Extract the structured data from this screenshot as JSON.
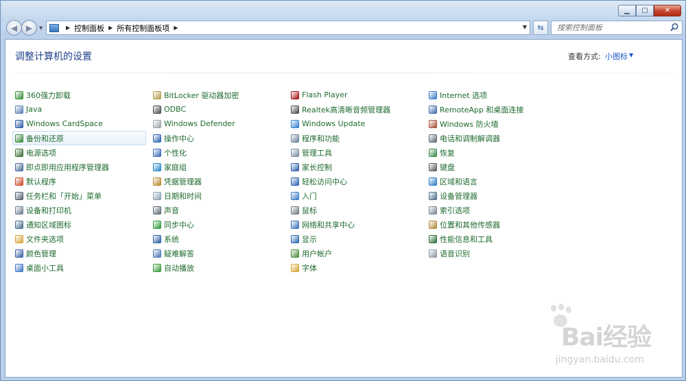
{
  "window": {
    "caption_buttons": [
      "minimize-icon",
      "maximize-icon",
      "close-icon"
    ]
  },
  "nav": {
    "breadcrumbs": [
      "控制面板",
      "所有控制面板项"
    ],
    "search_placeholder": "搜索控制面板"
  },
  "header": {
    "title": "调整计算机的设置",
    "view_by_label": "查看方式:",
    "view_by_value": "小图标"
  },
  "columns": [
    [
      {
        "label": "360强力卸载",
        "icon": "uninstall-icon",
        "color": "#3a8f3a"
      },
      {
        "label": "Java",
        "icon": "java-icon",
        "color": "#5b7fb5"
      },
      {
        "label": "Windows CardSpace",
        "icon": "cardspace-icon",
        "color": "#2a5ea8"
      },
      {
        "label": "备份和还原",
        "icon": "backup-icon",
        "color": "#3d8b3d"
      },
      {
        "label": "电源选项",
        "icon": "power-icon",
        "color": "#3c6e2e"
      },
      {
        "label": "即点即用应用程序管理器",
        "icon": "app-manager-icon",
        "color": "#4a6b9a"
      },
      {
        "label": "默认程序",
        "icon": "default-programs-icon",
        "color": "#d04a2a"
      },
      {
        "label": "任务栏和「开始」菜单",
        "icon": "taskbar-icon",
        "color": "#506070"
      },
      {
        "label": "设备和打印机",
        "icon": "printer-icon",
        "color": "#6a7c8f"
      },
      {
        "label": "通知区域图标",
        "icon": "notification-icon",
        "color": "#4b6d92"
      },
      {
        "label": "文件夹选项",
        "icon": "folder-options-icon",
        "color": "#d6a534"
      },
      {
        "label": "颜色管理",
        "icon": "color-management-icon",
        "color": "#3660a6"
      },
      {
        "label": "桌面小工具",
        "icon": "gadgets-icon",
        "color": "#3e78c4"
      }
    ],
    [
      {
        "label": "BitLocker 驱动器加密",
        "icon": "bitlocker-icon",
        "color": "#b59b4e"
      },
      {
        "label": "ODBC",
        "icon": "odbc-icon",
        "color": "#4b4b4b"
      },
      {
        "label": "Windows Defender",
        "icon": "defender-icon",
        "color": "#9aa4ad"
      },
      {
        "label": "操作中心",
        "icon": "action-center-icon",
        "color": "#2f62b6"
      },
      {
        "label": "个性化",
        "icon": "personalization-icon",
        "color": "#3b6bb5"
      },
      {
        "label": "家庭组",
        "icon": "homegroup-icon",
        "color": "#2a86c8"
      },
      {
        "label": "凭据管理器",
        "icon": "credential-icon",
        "color": "#b78a2b"
      },
      {
        "label": "日期和时间",
        "icon": "clock-icon",
        "color": "#8ea0b3"
      },
      {
        "label": "声音",
        "icon": "sound-icon",
        "color": "#5d6b78"
      },
      {
        "label": "同步中心",
        "icon": "sync-icon",
        "color": "#2e9b3c"
      },
      {
        "label": "系统",
        "icon": "system-icon",
        "color": "#2c5fa5"
      },
      {
        "label": "疑难解答",
        "icon": "troubleshoot-icon",
        "color": "#4a7ab6"
      },
      {
        "label": "自动播放",
        "icon": "autoplay-icon",
        "color": "#3a9a3a"
      }
    ],
    [
      {
        "label": "Flash Player",
        "icon": "flash-icon",
        "color": "#a31212"
      },
      {
        "label": "Realtek高清晰音频管理器",
        "icon": "audio-manager-icon",
        "color": "#4a4a4a"
      },
      {
        "label": "Windows Update",
        "icon": "update-icon",
        "color": "#2f7fd0"
      },
      {
        "label": "程序和功能",
        "icon": "programs-icon",
        "color": "#6b7f98"
      },
      {
        "label": "管理工具",
        "icon": "admin-tools-icon",
        "color": "#7a8ca0"
      },
      {
        "label": "家长控制",
        "icon": "parental-icon",
        "color": "#3060a8"
      },
      {
        "label": "轻松访问中心",
        "icon": "ease-of-access-icon",
        "color": "#2e63b5"
      },
      {
        "label": "入门",
        "icon": "getting-started-icon",
        "color": "#3c7dc8"
      },
      {
        "label": "鼠标",
        "icon": "mouse-icon",
        "color": "#707a84"
      },
      {
        "label": "网络和共享中心",
        "icon": "network-icon",
        "color": "#3770b8"
      },
      {
        "label": "显示",
        "icon": "display-icon",
        "color": "#2f68b0"
      },
      {
        "label": "用户帐户",
        "icon": "user-accounts-icon",
        "color": "#4d8c3c"
      },
      {
        "label": "字体",
        "icon": "fonts-icon",
        "color": "#d5a437"
      }
    ],
    [
      {
        "label": "Internet 选项",
        "icon": "internet-options-icon",
        "color": "#3a7fc8"
      },
      {
        "label": "RemoteApp 和桌面连接",
        "icon": "remoteapp-icon",
        "color": "#3e6da8"
      },
      {
        "label": "Windows 防火墙",
        "icon": "firewall-icon",
        "color": "#a8503a"
      },
      {
        "label": "电话和调制解调器",
        "icon": "phone-icon",
        "color": "#5f6b76"
      },
      {
        "label": "恢复",
        "icon": "recovery-icon",
        "color": "#3a8a4a"
      },
      {
        "label": "键盘",
        "icon": "keyboard-icon",
        "color": "#5a5a5a"
      },
      {
        "label": "区域和语言",
        "icon": "region-icon",
        "color": "#2f7ec4"
      },
      {
        "label": "设备管理器",
        "icon": "device-manager-icon",
        "color": "#4f6e8e"
      },
      {
        "label": "索引选项",
        "icon": "indexing-icon",
        "color": "#7a8594"
      },
      {
        "label": "位置和其他传感器",
        "icon": "location-icon",
        "color": "#b08a3a"
      },
      {
        "label": "性能信息和工具",
        "icon": "performance-icon",
        "color": "#2e6e3a"
      },
      {
        "label": "语音识别",
        "icon": "microphone-icon",
        "color": "#8d98a4"
      }
    ]
  ],
  "watermark": {
    "brand": "Bai经验",
    "url": "jingyan.baidu.com"
  }
}
